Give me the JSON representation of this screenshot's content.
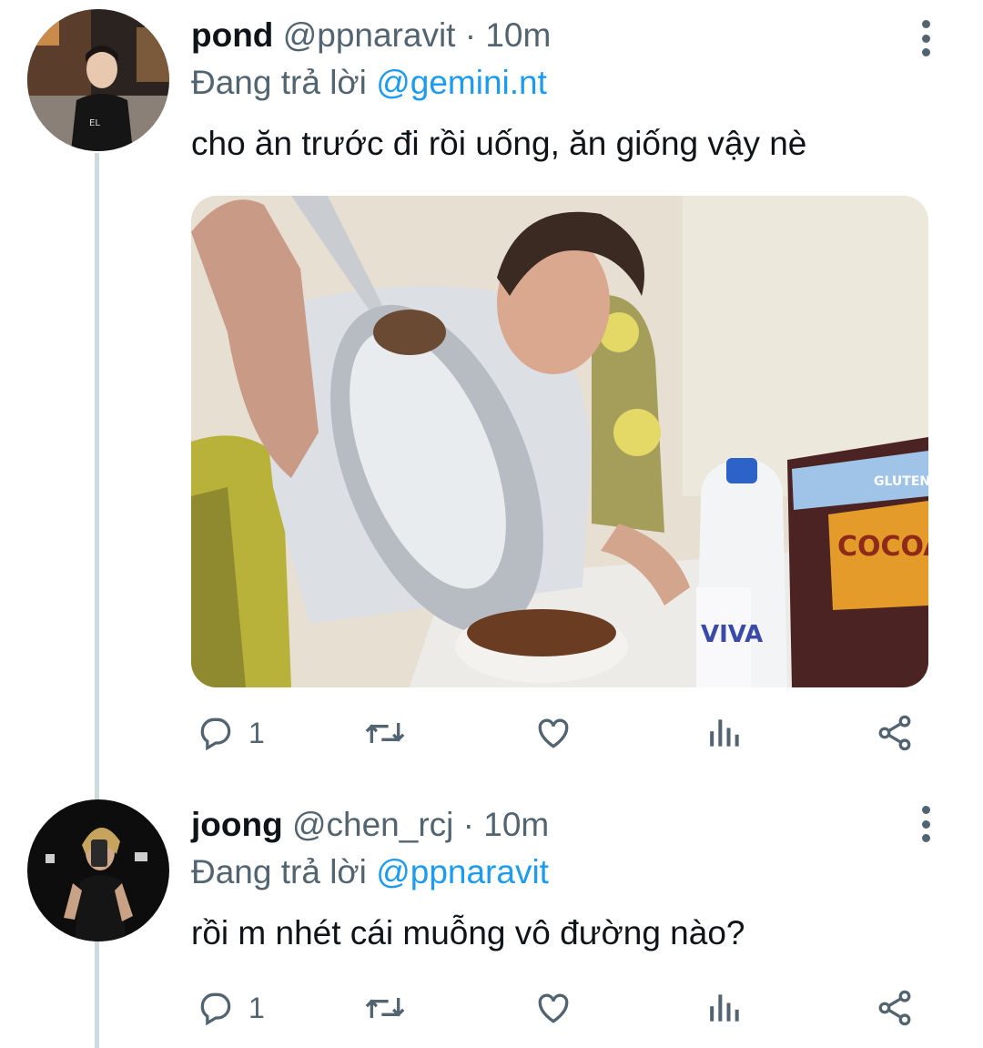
{
  "tweets": [
    {
      "display_name": "pond",
      "handle": "@ppnaravit",
      "separator": "·",
      "time": "10m",
      "replying_prefix": "Đang trả lời",
      "replying_to": "@gemini.nt",
      "text": "cho ăn trước đi rồi uống, ăn giống vậy nè",
      "reply_count": "1"
    },
    {
      "display_name": "joong",
      "handle": "@chen_rcj",
      "separator": "·",
      "time": "10m",
      "replying_prefix": "Đang trả lời",
      "replying_to": "@ppnaravit",
      "text": "rồi m nhét cái muỗng vô đường nào?",
      "reply_count": "1"
    }
  ],
  "media": {
    "milk_brand": "VIVA",
    "cereal_brand_top": "GLUTEN",
    "cereal_brand": "COCOA PEBBLES"
  },
  "icons": [
    "reply-icon",
    "retweet-icon",
    "like-icon",
    "analytics-icon",
    "share-icon",
    "more-icon"
  ],
  "colors": {
    "link": "#1d9bf0",
    "muted": "#536471",
    "thread_line": "#cfd9de"
  }
}
